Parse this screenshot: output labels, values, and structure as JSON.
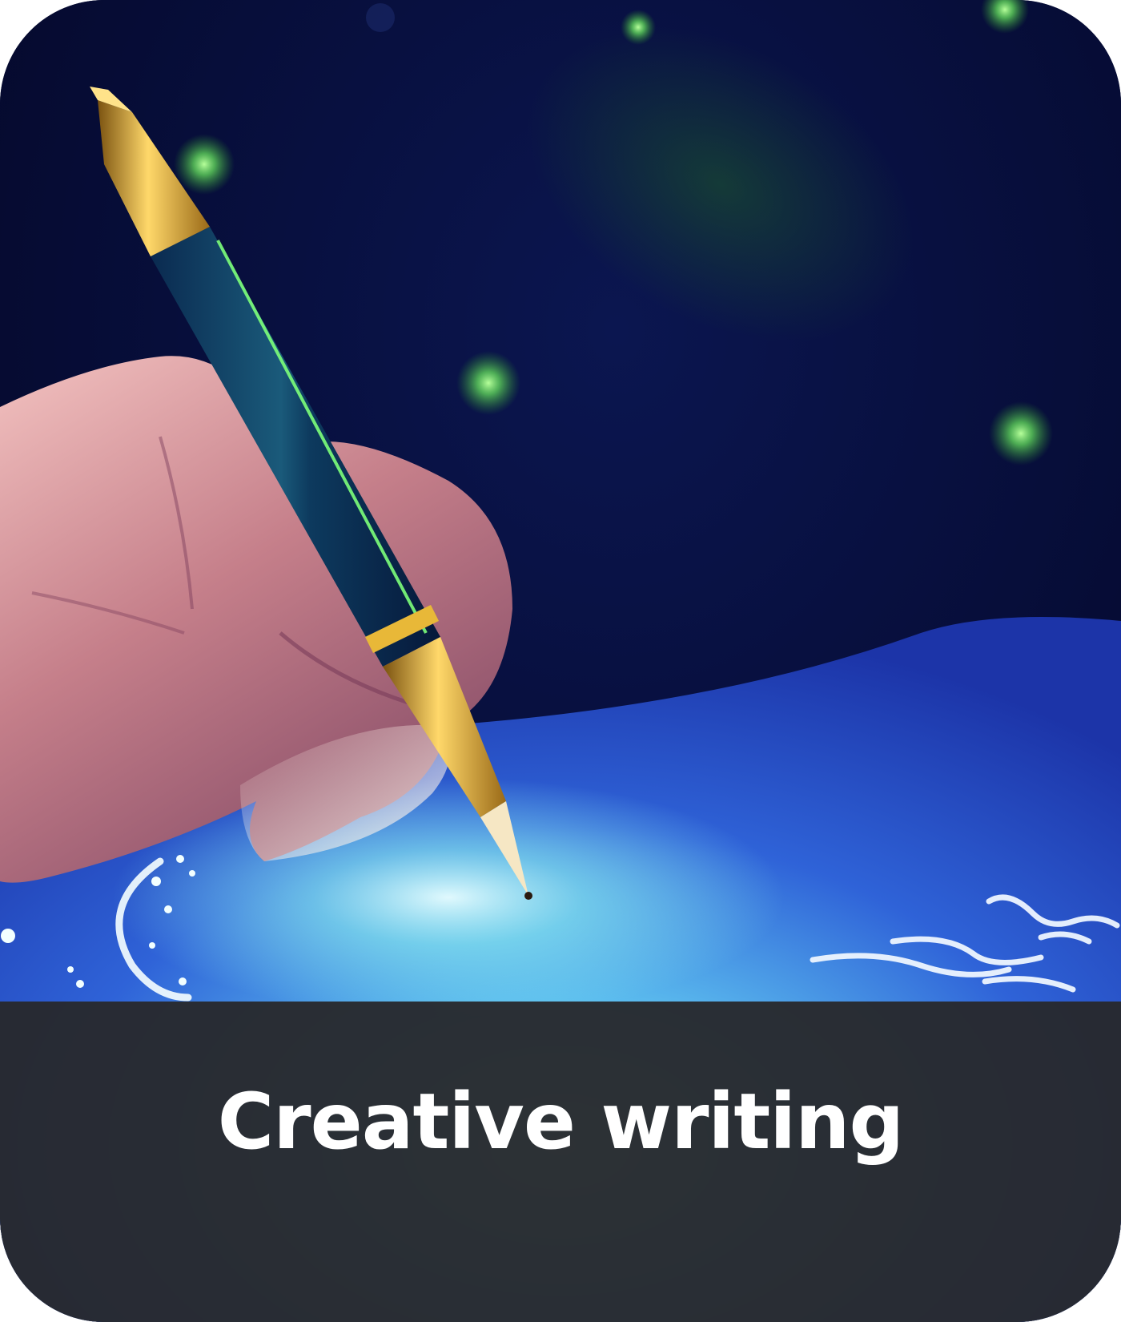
{
  "card": {
    "title": "Creative writing",
    "image": "hand-writing-with-golden-pen-on-glowing-blue-paper",
    "colors": {
      "night_sky": "#05082a",
      "paper_glow": "#8ff3f0",
      "caption_background": "#28292d",
      "caption_text": "#ffffff"
    }
  }
}
